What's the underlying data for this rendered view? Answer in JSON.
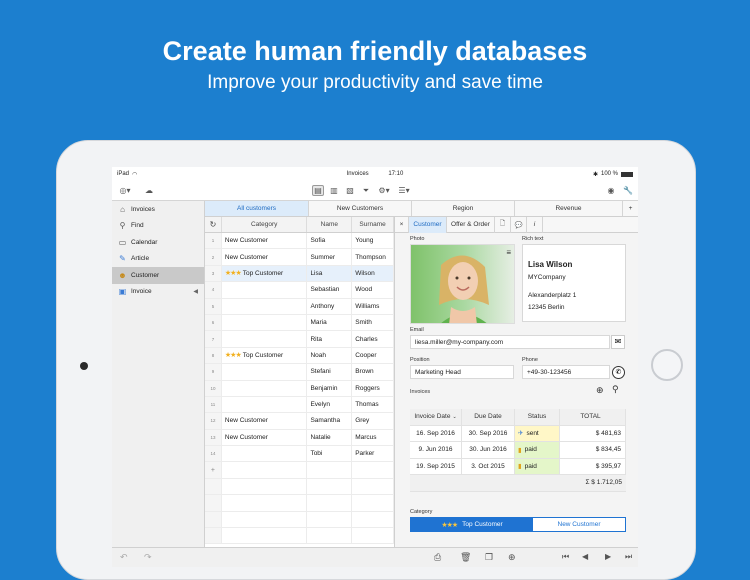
{
  "hero": {
    "title": "Create human friendly databases",
    "subtitle": "Improve your productivity and save time"
  },
  "statusbar": {
    "device": "iPad",
    "title": "Invoices",
    "time": "17:10",
    "battery": "100 %"
  },
  "sidebar": {
    "items": [
      {
        "label": "Invoices",
        "icon": "home-icon"
      },
      {
        "label": "Find",
        "icon": "search-icon"
      },
      {
        "label": "Calendar",
        "icon": "calendar-icon"
      },
      {
        "label": "Article",
        "icon": "article-icon"
      },
      {
        "label": "Customer",
        "icon": "customer-icon"
      },
      {
        "label": "Invoice",
        "icon": "invoice-icon"
      }
    ]
  },
  "tabs": [
    "All customers",
    "New Customers",
    "Region",
    "Revenue",
    "+"
  ],
  "table": {
    "headers": [
      "Category",
      "Name",
      "Surname"
    ],
    "rows": [
      {
        "n": "1",
        "category": "New Customer",
        "stars": "",
        "name": "Sofia",
        "surname": "Young"
      },
      {
        "n": "2",
        "category": "New Customer",
        "stars": "",
        "name": "Summer",
        "surname": "Thompson"
      },
      {
        "n": "3",
        "category": "Top Customer",
        "stars": "★★★",
        "name": "Lisa",
        "surname": "Wilson"
      },
      {
        "n": "4",
        "category": "",
        "stars": "",
        "name": "Sebastian",
        "surname": "Wood"
      },
      {
        "n": "5",
        "category": "",
        "stars": "",
        "name": "Anthony",
        "surname": "Williams"
      },
      {
        "n": "6",
        "category": "",
        "stars": "",
        "name": "Maria",
        "surname": "Smith"
      },
      {
        "n": "7",
        "category": "",
        "stars": "",
        "name": "Rita",
        "surname": "Charles"
      },
      {
        "n": "8",
        "category": "Top Customer",
        "stars": "★★★",
        "name": "Noah",
        "surname": "Cooper"
      },
      {
        "n": "9",
        "category": "",
        "stars": "",
        "name": "Stefani",
        "surname": "Brown"
      },
      {
        "n": "10",
        "category": "",
        "stars": "",
        "name": "Benjamin",
        "surname": "Roggers"
      },
      {
        "n": "11",
        "category": "",
        "stars": "",
        "name": "Evelyn",
        "surname": "Thomas"
      },
      {
        "n": "12",
        "category": "New Customer",
        "stars": "",
        "name": "Samantha",
        "surname": "Grey"
      },
      {
        "n": "13",
        "category": "New Customer",
        "stars": "",
        "name": "Natalie",
        "surname": "Marcus"
      },
      {
        "n": "14",
        "category": "",
        "stars": "",
        "name": "Tobi",
        "surname": "Parker"
      }
    ],
    "add_row": "+"
  },
  "detail": {
    "tabs": [
      "Customer",
      "Offer & Order"
    ],
    "close": "×",
    "photo_label": "Photo",
    "rich_label": "Rich text",
    "rich": {
      "name": "Lisa Wilson",
      "company": "MYCompany",
      "street": "Alexanderplatz 1",
      "city": "12345 Berlin"
    },
    "email_label": "Email",
    "email": "liesa.miller@my-company.com",
    "position_label": "Position",
    "position": "Marketing Head",
    "phone_label": "Phone",
    "phone": "+49-30-123456",
    "invoices_label": "Invoices",
    "invoice_headers": [
      "Invoice Date",
      "Due Date",
      "Status",
      "TOTAL"
    ],
    "invoices": [
      {
        "date": "16. Sep 2016",
        "due": "30. Sep 2016",
        "status": "sent",
        "total": "$ 481,63"
      },
      {
        "date": "9. Jun 2016",
        "due": "30. Jun 2016",
        "status": "paid",
        "total": "$ 834,45"
      },
      {
        "date": "19. Sep 2015",
        "due": "3. Oct 2015",
        "status": "paid",
        "total": "$ 395,97"
      }
    ],
    "sum": "Σ $ 1.712,05",
    "category_label": "Category",
    "category_on": "Top Customer",
    "category_off": "New Customer"
  }
}
